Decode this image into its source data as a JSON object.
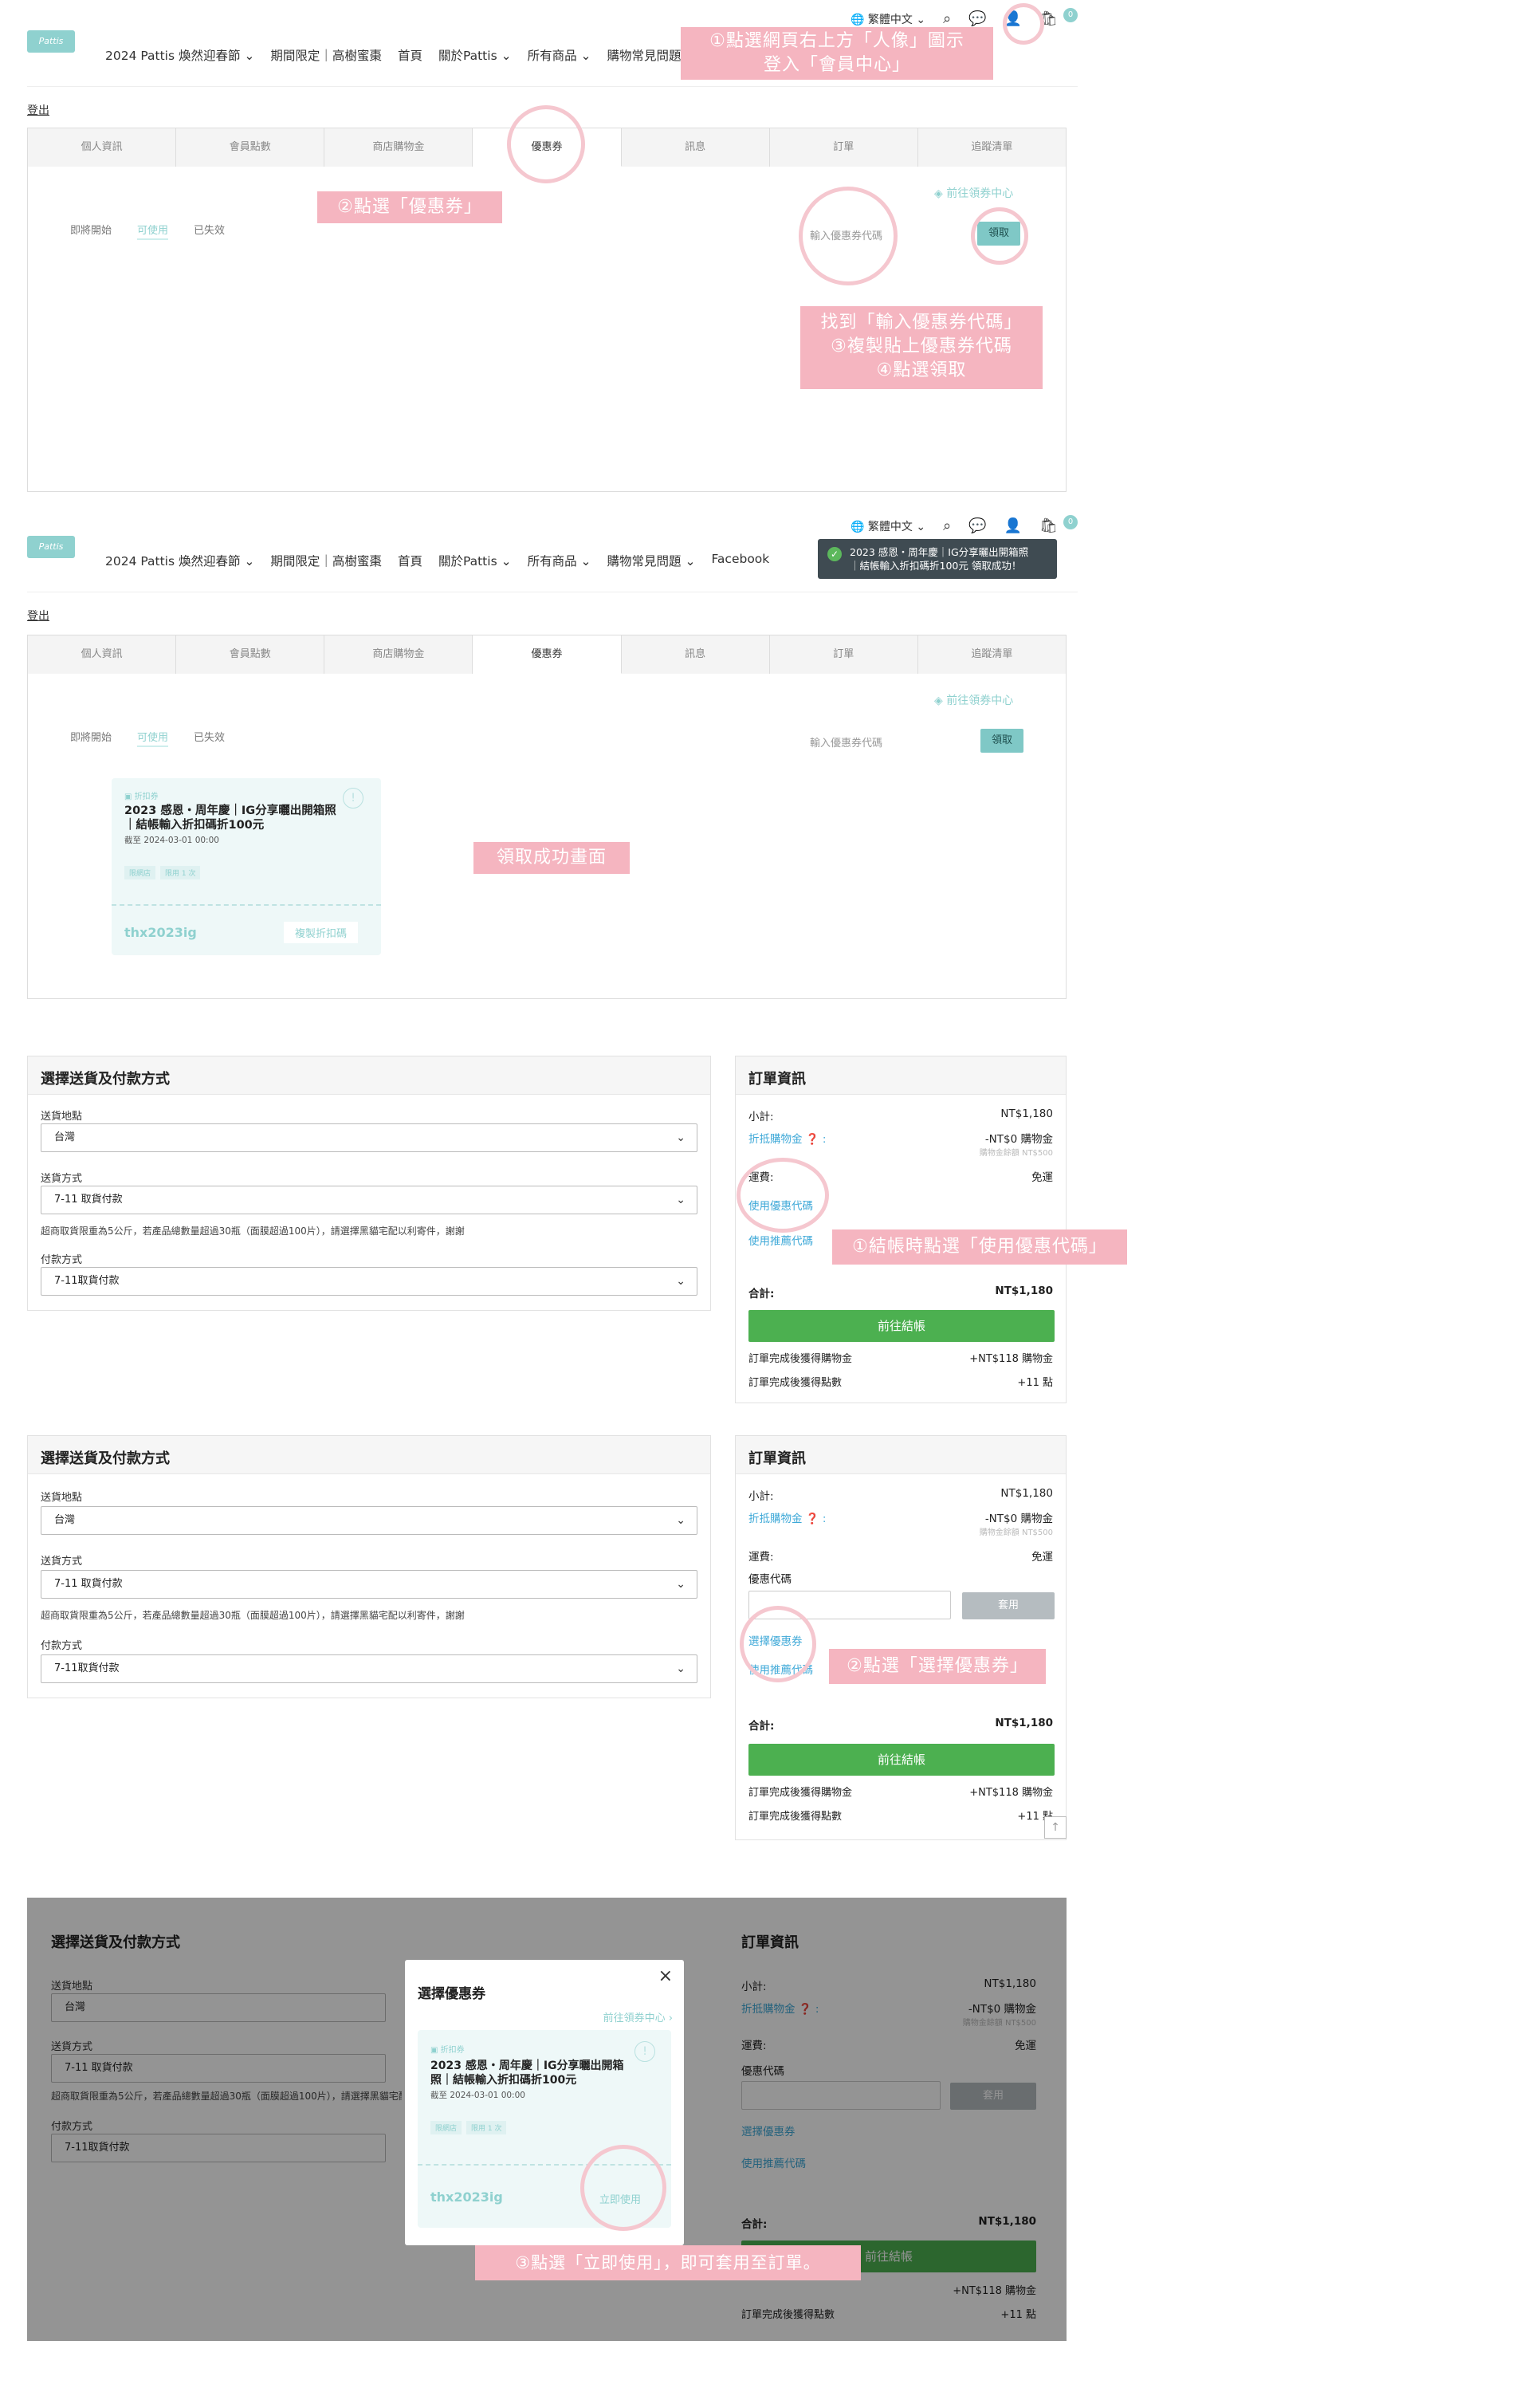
{
  "header": {
    "logo_text": "Pattis",
    "language": "繁體中文",
    "cart_count": "0",
    "nav_items": [
      "2024 Pattis 煥然迎春節",
      "期間限定｜高樹蜜棗",
      "首頁",
      "關於Pattis",
      "所有商品",
      "購物常見問題"
    ],
    "nav_extra": "Facebook"
  },
  "account": {
    "logout": "登出",
    "tabs": [
      "個人資訊",
      "會員點數",
      "商店購物金",
      "優惠券",
      "訊息",
      "訂單",
      "追蹤清單"
    ],
    "coupon_filters": [
      "即將開始",
      "可使用",
      "已失效"
    ],
    "coupon_center_link": "前往領券中心",
    "code_placeholder": "輸入優惠券代碼",
    "claim_button": "領取"
  },
  "toast": {
    "text_line1": "2023 感恩・周年慶｜IG分享曬出開箱照",
    "text_line2": "｜結帳輸入折扣碼折100元 領取成功！"
  },
  "coupon": {
    "tag": "折扣券",
    "title_line1": "2023 感恩・周年慶｜IG分享曬出開箱照",
    "title_line2": "｜結帳輸入折扣碼折100元",
    "title_modal_line1": "2023 感恩・周年慶｜IG分享曬出開箱",
    "title_modal_line2": "照｜結帳輸入折扣碼折100元",
    "expiry": "截至 2024-03-01 00:00",
    "chips": [
      "限網店",
      "限用 1 次"
    ],
    "code": "thx2023ig",
    "copy_button": "複製折扣碼",
    "use_now": "立即使用"
  },
  "checkout": {
    "left_title": "選擇送貨及付款方式",
    "delivery_location_label": "送貨地點",
    "delivery_location_value": "台灣",
    "delivery_method_label": "送貨方式",
    "delivery_method_value": "7-11 取貨付款",
    "delivery_hint": "超商取貨限重為5公斤，若產品總數量超過30瓶（面膜超過100片），請選擇黑貓宅配以利寄件，謝謝",
    "payment_label": "付款方式",
    "payment_value": "7-11取貨付款",
    "right_title": "訂單資訊",
    "subtotal_label": "小計:",
    "subtotal_value": "NT$1,180",
    "credit_label": "折抵購物金",
    "credit_value": "-NT$0 購物金",
    "credit_note": "購物金餘額 NT$500",
    "shipping_label": "運費:",
    "shipping_value": "免運",
    "use_coupon_code": "使用優惠代碼",
    "use_referral_code": "使用推薦代碼",
    "coupon_code_label": "優惠代碼",
    "apply_button": "套用",
    "select_coupon": "選擇優惠券",
    "total_label": "合計:",
    "total_value": "NT$1,180",
    "checkout_button": "前往結帳",
    "earn_credit_label": "訂單完成後獲得購物金",
    "earn_credit_value": "+NT$118 購物金",
    "earn_points_label": "訂單完成後獲得點數",
    "earn_points_value": "+11 點"
  },
  "modal": {
    "title": "選擇優惠券",
    "coupon_center_link": "前往領券中心",
    "close": "×"
  },
  "notes": {
    "n1_line1": "①點選網頁右上方「人像」圖示",
    "n1_line2": "登入「會員中心」",
    "n2": "②點選「優惠券」",
    "n3_line1": "找到「輸入優惠券代碼」",
    "n3_line2": "③複製貼上優惠券代碼",
    "n3_line3": "④點選領取",
    "n4": "領取成功畫面",
    "n5": "①結帳時點選「使用優惠代碼」",
    "n6": "②點選「選擇優惠券」",
    "n7": "③點選「立即使用」，即可套用至訂單。"
  },
  "colors": {
    "accent": "#8fd1cf",
    "note_pink": "#f5b5c0",
    "green": "#4cb050"
  }
}
